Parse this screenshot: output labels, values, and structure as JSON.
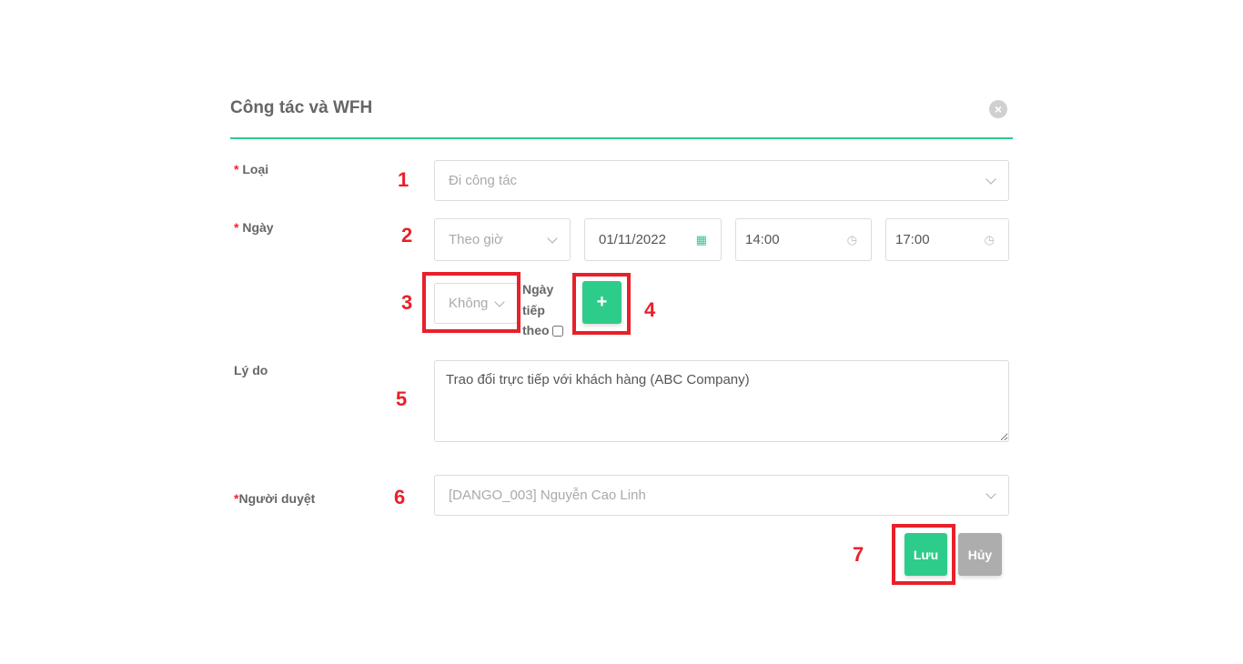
{
  "dialog": {
    "title": "Công tác và WFH",
    "close_icon": "close-circle-icon",
    "accent": "#2ecc8a",
    "fields": {
      "type": {
        "required": "*",
        "label": "Loại",
        "value": "Đi công tác"
      },
      "date": {
        "required": "*",
        "label": "Ngày",
        "mode": "Theo giờ",
        "date": "01/11/2022",
        "start_time": "14:00",
        "end_time": "17:00"
      },
      "repeat": {
        "value": "Không",
        "next_day_label_1": "Ngày",
        "next_day_label_2": "tiếp",
        "next_day_label_3": "theo",
        "next_day_checked": false,
        "add_label": "+"
      },
      "reason": {
        "label": "Lý do",
        "value": "Trao đổi trực tiếp với khách hàng (ABC Company)"
      },
      "approver": {
        "required": "*",
        "label": "Người duyệt",
        "value": "[DANGO_003] Nguyễn Cao Linh"
      }
    },
    "actions": {
      "save": "Lưu",
      "cancel": "Hủy"
    }
  },
  "annotations": {
    "color": "#e8202a",
    "n1": "1",
    "n2": "2",
    "n3": "3",
    "n4": "4",
    "n5": "5",
    "n6": "6",
    "n7": "7"
  }
}
